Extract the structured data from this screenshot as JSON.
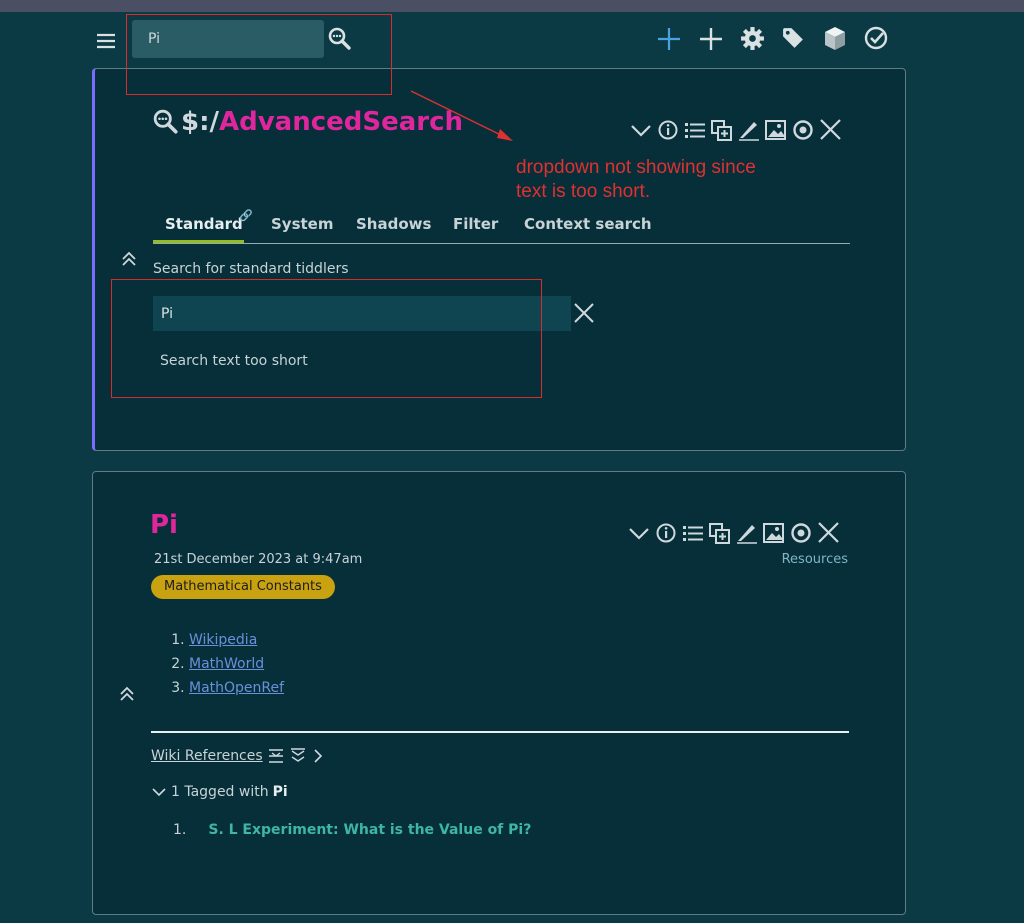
{
  "topbar": {
    "search_value": "Pi",
    "colors": {
      "new_accent": "#4aa3e0",
      "icon": "#d9e1e3"
    },
    "icons": [
      "menu-icon",
      "search-icon",
      "new-journal-icon",
      "new-tiddler-icon",
      "gear-icon",
      "tag-icon",
      "cube-icon",
      "checkmark-icon"
    ]
  },
  "advanced_search": {
    "title_prefix": "$:/",
    "title_main": "AdvancedSearch",
    "tabs": [
      {
        "label": "Standard"
      },
      {
        "label": "System"
      },
      {
        "label": "Shadows"
      },
      {
        "label": "Filter"
      },
      {
        "label": "Context search"
      }
    ],
    "active_tab": "Standard",
    "sub_label": "Search for standard tiddlers",
    "search_value": "Pi",
    "message": "Search text too short"
  },
  "annotation": {
    "text_line1": "dropdown not showing since",
    "text_line2": "text is too short.",
    "color": "#e03030"
  },
  "pi_tiddler": {
    "title": "Pi",
    "date": "21st December 2023 at 9:47am",
    "tag": "Mathematical Constants",
    "resources_label": "Resources",
    "links": [
      {
        "label": "Wikipedia"
      },
      {
        "label": "MathWorld"
      },
      {
        "label": "MathOpenRef"
      }
    ],
    "wiki_references": "Wiki References",
    "tagged_prefix": "1 Tagged with",
    "tagged_name": "Pi",
    "tagged_items": [
      {
        "num": "1.",
        "label": "S. L Experiment: What is the Value of Pi?"
      }
    ]
  }
}
